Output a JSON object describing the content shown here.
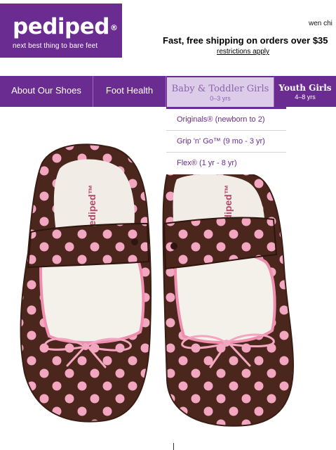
{
  "brand": {
    "name": "pediped",
    "mark": "®",
    "tagline": "next best thing to bare feet",
    "color": "#6a2c91"
  },
  "header": {
    "user_text": "wen chi",
    "shipping_text": "Fast, free shipping on orders over $35",
    "restrictions_link": "restrictions apply"
  },
  "nav": {
    "items": [
      {
        "label": "About Our Shoes"
      },
      {
        "label": "Foot Health"
      },
      {
        "label": "Baby & Toddler Girls",
        "sub": "0–3 yrs"
      },
      {
        "label": "Youth Girls",
        "sub": "4–8 yrs"
      }
    ],
    "active_index": 2
  },
  "dropdown": {
    "items": [
      {
        "label": "Originals® (newborn to 2)"
      },
      {
        "label": "Grip 'n' Go™ (9 mo - 3 yr)"
      },
      {
        "label": "Flex® (1 yr - 8 yr)"
      }
    ]
  },
  "product_image": {
    "shoe_color": "#4a261c",
    "dot_color": "#f2a6bf",
    "insole_label": "pediped™"
  }
}
